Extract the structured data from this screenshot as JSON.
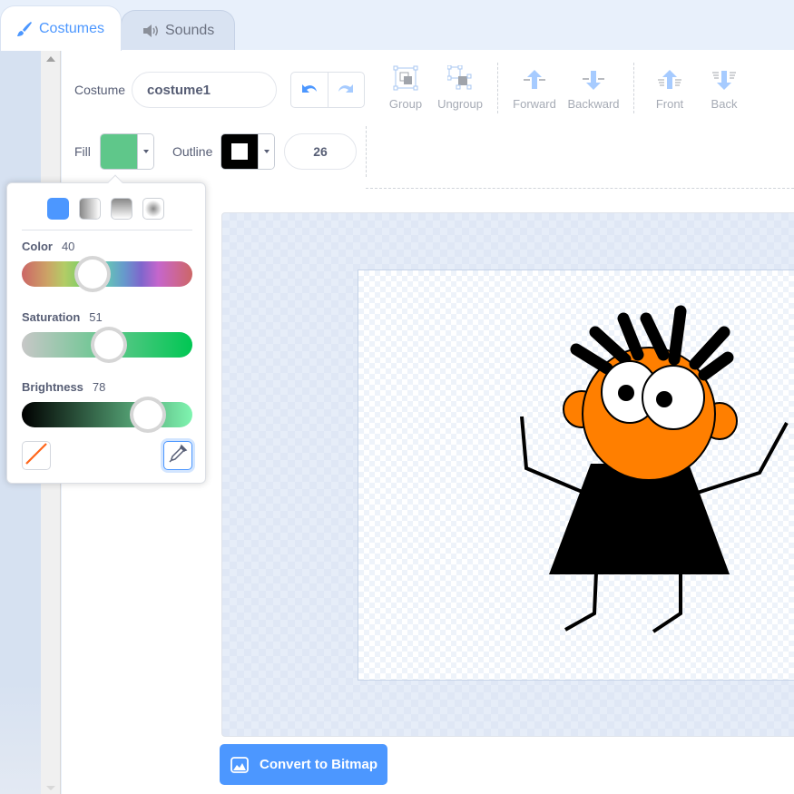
{
  "tabs": [
    {
      "label": "Costumes",
      "icon": "brush-icon",
      "active": true
    },
    {
      "label": "Sounds",
      "icon": "speaker-icon",
      "active": false
    }
  ],
  "toolbar": {
    "costume_label": "Costume",
    "costume_name": "costume1",
    "undo_icon": "undo-icon",
    "redo_icon": "redo-icon",
    "group_label": "Group",
    "ungroup_label": "Ungroup",
    "forward_label": "Forward",
    "backward_label": "Backward",
    "front_label": "Front",
    "back_label": "Back",
    "fill_label": "Fill",
    "fill_color": "#5fc78a",
    "outline_label": "Outline",
    "outline_color": "#000000",
    "outline_width": "26"
  },
  "color_picker": {
    "gradient_options": [
      "solid",
      "horizontal",
      "vertical",
      "radial"
    ],
    "selected_gradient": "solid",
    "color_label": "Color",
    "color_value": 40,
    "saturation_label": "Saturation",
    "saturation_value": 51,
    "brightness_label": "Brightness",
    "brightness_value": 78,
    "no_color_icon": "no-color-icon",
    "eyedropper_icon": "eyedropper-icon"
  },
  "canvas": {
    "costume": "orange-haired character in black dress"
  },
  "convert_button": {
    "label": "Convert to Bitmap",
    "icon": "bitmap-icon"
  },
  "colors": {
    "accent": "#4c97ff",
    "character_orange": "#ff7f00"
  }
}
